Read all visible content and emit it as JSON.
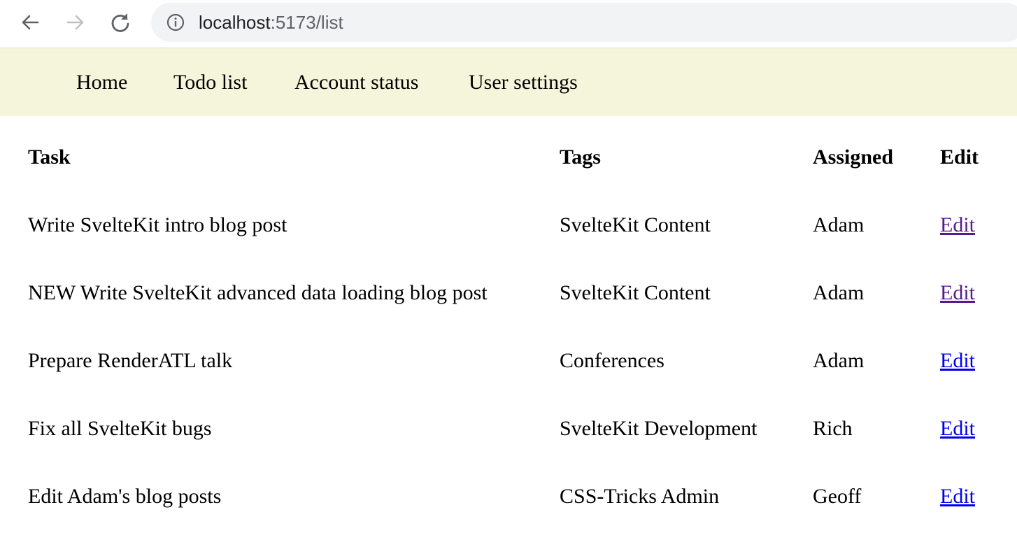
{
  "browser": {
    "url_host": "localhost",
    "url_path": ":5173/list"
  },
  "nav": {
    "items": [
      {
        "label": "Home"
      },
      {
        "label": "Todo list"
      },
      {
        "label": "Account status"
      },
      {
        "label": "User settings"
      }
    ]
  },
  "table": {
    "headers": {
      "task": "Task",
      "tags": "Tags",
      "assigned": "Assigned",
      "edit": "Edit"
    },
    "rows": [
      {
        "task": "Write SvelteKit intro blog post",
        "tags": "SvelteKit Content",
        "assigned": "Adam",
        "edit": "Edit",
        "edit_visited": true
      },
      {
        "task": "NEW Write SvelteKit advanced data loading blog post",
        "tags": "SvelteKit Content",
        "assigned": "Adam",
        "edit": "Edit",
        "edit_visited": true
      },
      {
        "task": "Prepare RenderATL talk",
        "tags": "Conferences",
        "assigned": "Adam",
        "edit": "Edit",
        "edit_visited": false
      },
      {
        "task": "Fix all SvelteKit bugs",
        "tags": "SvelteKit Development",
        "assigned": "Rich",
        "edit": "Edit",
        "edit_visited": false
      },
      {
        "task": "Edit Adam's blog posts",
        "tags": "CSS-Tricks Admin",
        "assigned": "Geoff",
        "edit": "Edit",
        "edit_visited": false
      }
    ]
  },
  "colors": {
    "nav_background": "#f5f5dc",
    "link": "#0000ee",
    "link_visited": "#551a8b",
    "address_bar": "#f1f3f4"
  }
}
